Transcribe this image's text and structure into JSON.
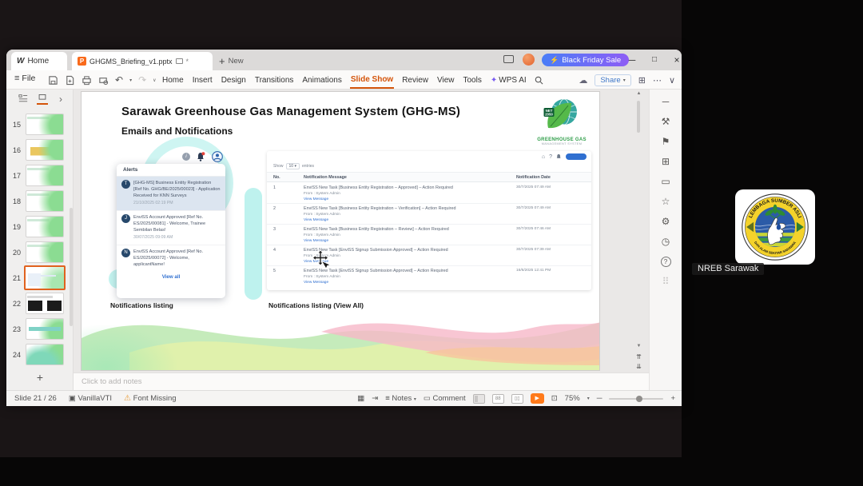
{
  "window": {
    "home_tab": "Home",
    "doc_tab": "GHGMS_Briefing_v1.pptx",
    "new_tab": "New",
    "promo": "Black Friday Sale"
  },
  "menubar": {
    "file": "File",
    "items": [
      "Home",
      "Insert",
      "Design",
      "Transitions",
      "Animations",
      "Slide Show",
      "Review",
      "View",
      "Tools",
      "WPS AI"
    ],
    "active_item": "Slide Show",
    "share": "Share"
  },
  "slide_panel": {
    "slides": [
      "15",
      "16",
      "17",
      "18",
      "19",
      "20",
      "21",
      "22",
      "23",
      "24"
    ],
    "selected": "21"
  },
  "slide": {
    "title": "Sarawak Greenhouse Gas Management System (GHG-MS)",
    "subtitle": "Emails and Notifications",
    "logo": {
      "badge_top": "NET",
      "badge_bottom": "2050",
      "name": "GREENHOUSE GAS",
      "tagline": "MANAGEMENT SYSTEM"
    },
    "alerts": {
      "title": "Alerts",
      "items": [
        {
          "avatar": "T",
          "text": "[GHG-MS] Business Entity Registration [Ref No. GHG/BE/2025/00023] - Application Received for KNN Surveys",
          "time": "21/10/2025 02:19 PM"
        },
        {
          "avatar": "J",
          "text": "EnviSS Account Approved [Ref No. ES/2025/00081] - Welcome, Trainee Sembilan Belas!",
          "time": "30/07/2025 09:09 AM"
        },
        {
          "avatar": "N",
          "text": "EnviSS Account Approved [Ref No. ES/2025/00072] - Welcome, applicantName!",
          "time": ""
        }
      ],
      "view_all": "View all"
    },
    "table": {
      "show_label": "Show",
      "show_value": "10",
      "entries_label": "entries",
      "columns": [
        "No.",
        "Notification Message",
        "Notification Date"
      ],
      "rows": [
        {
          "no": "1",
          "message": "EnviSS New Task [Business Entity Registration – Approved] – Action Required",
          "from": "From : System Admin",
          "link": "View Message",
          "date": "30/7/2025 07:49 AM"
        },
        {
          "no": "2",
          "message": "EnviSS New Task [Business Entity Registration – Verification] – Action Required",
          "from": "From : System Admin",
          "link": "View Message",
          "date": "30/7/2025 07:49 AM"
        },
        {
          "no": "3",
          "message": "EnviSS New Task [Business Entity Registration – Review] – Action Required",
          "from": "From : System Admin",
          "link": "View Message",
          "date": "30/7/2025 07:46 AM"
        },
        {
          "no": "4",
          "message": "EnviSS New Task [EnviSS Signup Submission Approved] – Action Required",
          "from": "From : System Admin",
          "link": "View Message",
          "date": "30/7/2025 07:39 AM"
        },
        {
          "no": "5",
          "message": "EnviSS New Task [EnviSS Signup Submission Approved] – Action Required",
          "from": "From : System Admin",
          "link": "View Message",
          "date": "16/6/2025 12:41 PM"
        }
      ]
    },
    "caption_left": "Notifications listing",
    "caption_right": "Notifications listing (View All)"
  },
  "notes": {
    "placeholder": "Click to add notes"
  },
  "statusbar": {
    "slide_indicator": "Slide 21 / 26",
    "theme": "VanillaVTI",
    "font_missing": "Font Missing",
    "notes": "Notes",
    "comment": "Comment",
    "sorter_glyph": "88",
    "reading_glyph": "▯▯",
    "zoom": "75%"
  },
  "meeting": {
    "participant": "NREB Sarawak",
    "logo_top": "LEMBAGA SUMBER ASLI",
    "logo_bottom": "DAN ALAM SEKITAR SARAWAK"
  },
  "icons": {
    "close": "×",
    "minimize": "─",
    "restore": "□",
    "plus": "+",
    "caret": "▾",
    "chevron_right": "›",
    "lightning": "⚡",
    "cloud": "☁",
    "hamburger": "≡",
    "undo": "↶",
    "redo": "↷",
    "collapse": "∨",
    "more": "⋯",
    "panel": "⊞",
    "wps_spark": "✦",
    "info": "i",
    "warning": "⚠",
    "grid": "▦",
    "layout": "▣",
    "goto": "⇥",
    "play": "▶",
    "fit": "⊡",
    "scroll_up": "▲",
    "scroll_down": "▼",
    "prev2": "⇈",
    "next2": "⇊",
    "tool_dash": "─",
    "tool_tools": "⚒",
    "tool_flag": "⚑",
    "tool_copy": "⊞",
    "tool_comment": "▭",
    "tool_star": "☆",
    "tool_gear": "⚙",
    "tool_clock": "◷",
    "tool_help": "?",
    "tool_grid": "⠿",
    "home": "⌂",
    "question": "?",
    "asterisk": "*"
  },
  "colors": {
    "accent_orange": "#d4540a",
    "promo_gradient_start": "#4a7df7",
    "promo_gradient_end": "#8e5df5",
    "link_blue": "#2f6fd0",
    "brand_green": "#2f9e49",
    "play_orange": "#ff7a1a"
  }
}
